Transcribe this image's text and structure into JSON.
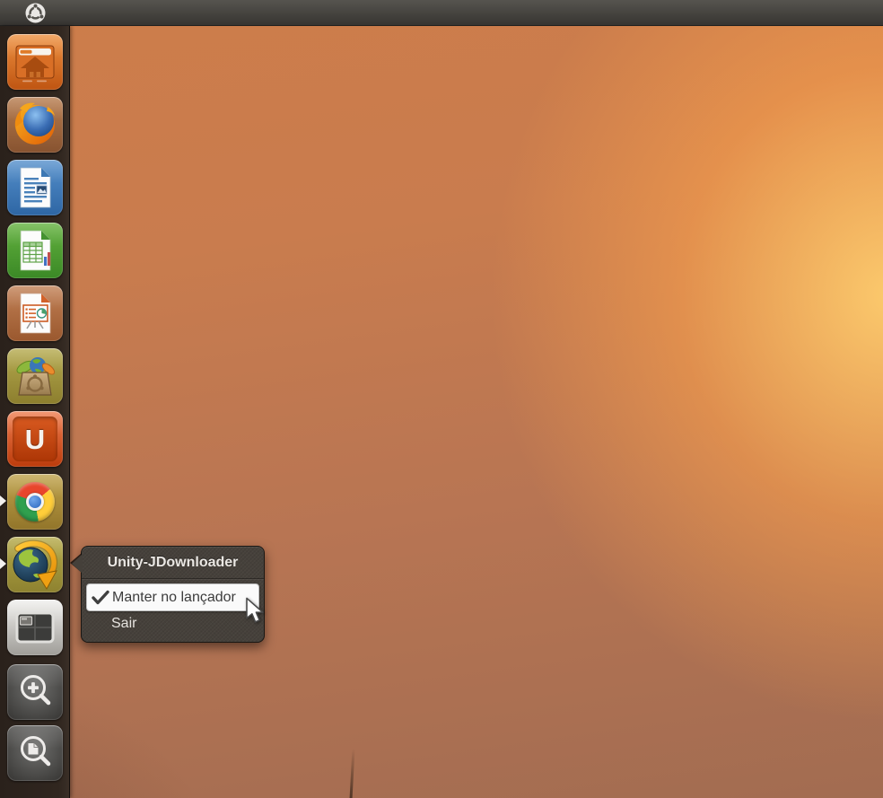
{
  "panel": {
    "logo_icon": "ubuntu-circle-of-friends"
  },
  "launcher": {
    "items": [
      {
        "name": "home-folder"
      },
      {
        "name": "firefox"
      },
      {
        "name": "libreoffice-writer"
      },
      {
        "name": "libreoffice-calc"
      },
      {
        "name": "libreoffice-impress"
      },
      {
        "name": "ubuntu-software-center"
      },
      {
        "name": "ubuntu-one",
        "glyph": "U"
      },
      {
        "name": "google-chrome",
        "running": true
      },
      {
        "name": "jdownloader",
        "running": true,
        "menu_open": true
      },
      {
        "name": "workspace-switcher"
      },
      {
        "name": "zoom-lens"
      },
      {
        "name": "find-files-lens"
      }
    ]
  },
  "quicklist": {
    "title": "Unity-JDownloader",
    "items": [
      {
        "label": "Manter no lançador",
        "checked": true,
        "highlighted": true
      },
      {
        "label": "Sair",
        "checked": false,
        "highlighted": false
      }
    ]
  },
  "colors": {
    "panel": "#403e3a",
    "launcher_bg": "#2d231d",
    "menu_bg": "#45403a",
    "menu_highlight": "#fafafa",
    "wallpaper_sun": "#ffce6e",
    "wallpaper_base": "#c97c4e"
  }
}
